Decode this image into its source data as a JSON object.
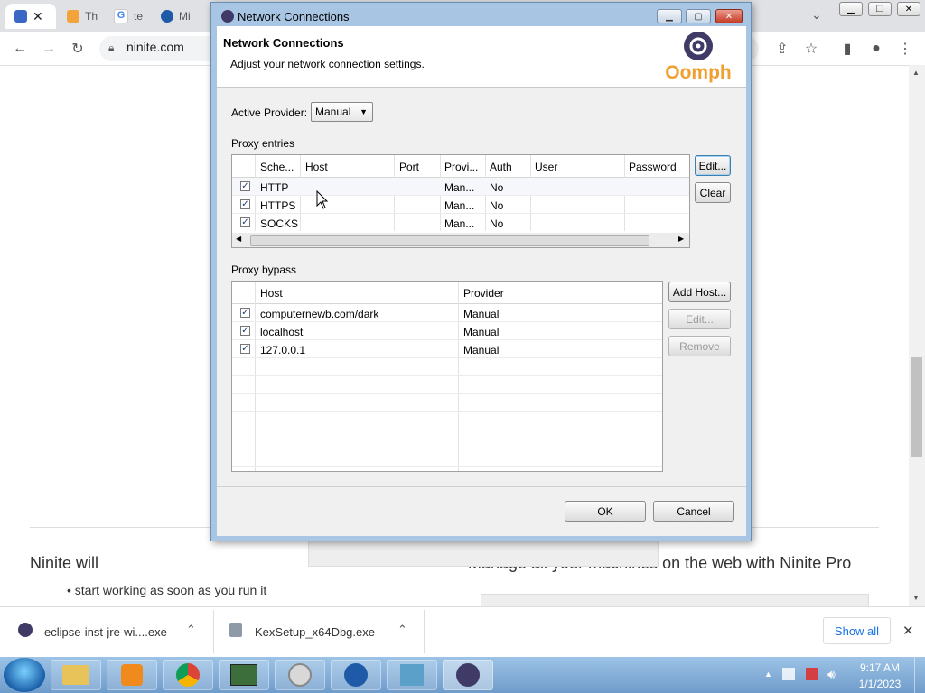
{
  "browser": {
    "tabs": [
      {
        "label": ""
      },
      {
        "label": "Th"
      },
      {
        "label": "te"
      },
      {
        "label": "Mi"
      }
    ],
    "url": "ninite.com",
    "icons": {
      "back": "arrow-left-icon",
      "forward": "arrow-right-icon",
      "reload": "reload-icon",
      "lock": "lock-icon",
      "share": "share-icon",
      "star": "star-icon",
      "sidepanel": "side-panel-icon",
      "profile": "profile-icon",
      "menu": "kebab-menu-icon"
    }
  },
  "page": {
    "ninite_will": "Ninite will",
    "bullet": "start working as soon as you run it",
    "pro_heading": "Manage all your machines on the web with Ninite Pro"
  },
  "dialog": {
    "window_title": "Network Connections",
    "header_title": "Network Connections",
    "header_subtitle": "Adjust your network connection settings.",
    "logo_text": "Oomph",
    "active_provider_label": "Active Provider:",
    "active_provider_value": "Manual",
    "proxy_entries_label": "Proxy entries",
    "proxy_columns": [
      "Sche...",
      "Host",
      "Port",
      "Provi...",
      "Auth",
      "User",
      "Password"
    ],
    "proxy_rows": [
      {
        "checked": "✓",
        "scheme": "HTTP",
        "host": "",
        "port": "",
        "provider": "Man...",
        "auth": "No",
        "user": "",
        "password": ""
      },
      {
        "checked": "✓",
        "scheme": "HTTPS",
        "host": "",
        "port": "",
        "provider": "Man...",
        "auth": "No",
        "user": "",
        "password": ""
      },
      {
        "checked": "✓",
        "scheme": "SOCKS",
        "host": "",
        "port": "",
        "provider": "Man...",
        "auth": "No",
        "user": "",
        "password": ""
      }
    ],
    "edit_button": "Edit...",
    "clear_button": "Clear",
    "proxy_bypass_label": "Proxy bypass",
    "bypass_columns": [
      "Host",
      "Provider"
    ],
    "bypass_rows": [
      {
        "checked": "✓",
        "host": "computernewb.com/dark",
        "provider": "Manual"
      },
      {
        "checked": "✓",
        "host": "localhost",
        "provider": "Manual"
      },
      {
        "checked": "✓",
        "host": "127.0.0.1",
        "provider": "Manual"
      }
    ],
    "add_host_button": "Add Host...",
    "bypass_edit_button": "Edit...",
    "remove_button": "Remove",
    "ok_button": "OK",
    "cancel_button": "Cancel"
  },
  "downloads": {
    "items": [
      {
        "name": "eclipse-inst-jre-wi....exe"
      },
      {
        "name": "KexSetup_x64Dbg.exe"
      }
    ],
    "show_all": "Show all"
  },
  "taskbar": {
    "time": "9:17 AM",
    "date": "1/1/2023"
  },
  "colors": {
    "dialog_border": "#a8c6e4",
    "taskbar": "#6f9ccb",
    "oomph_purple": "#3f3a66",
    "oomph_orange": "#f0a030"
  }
}
